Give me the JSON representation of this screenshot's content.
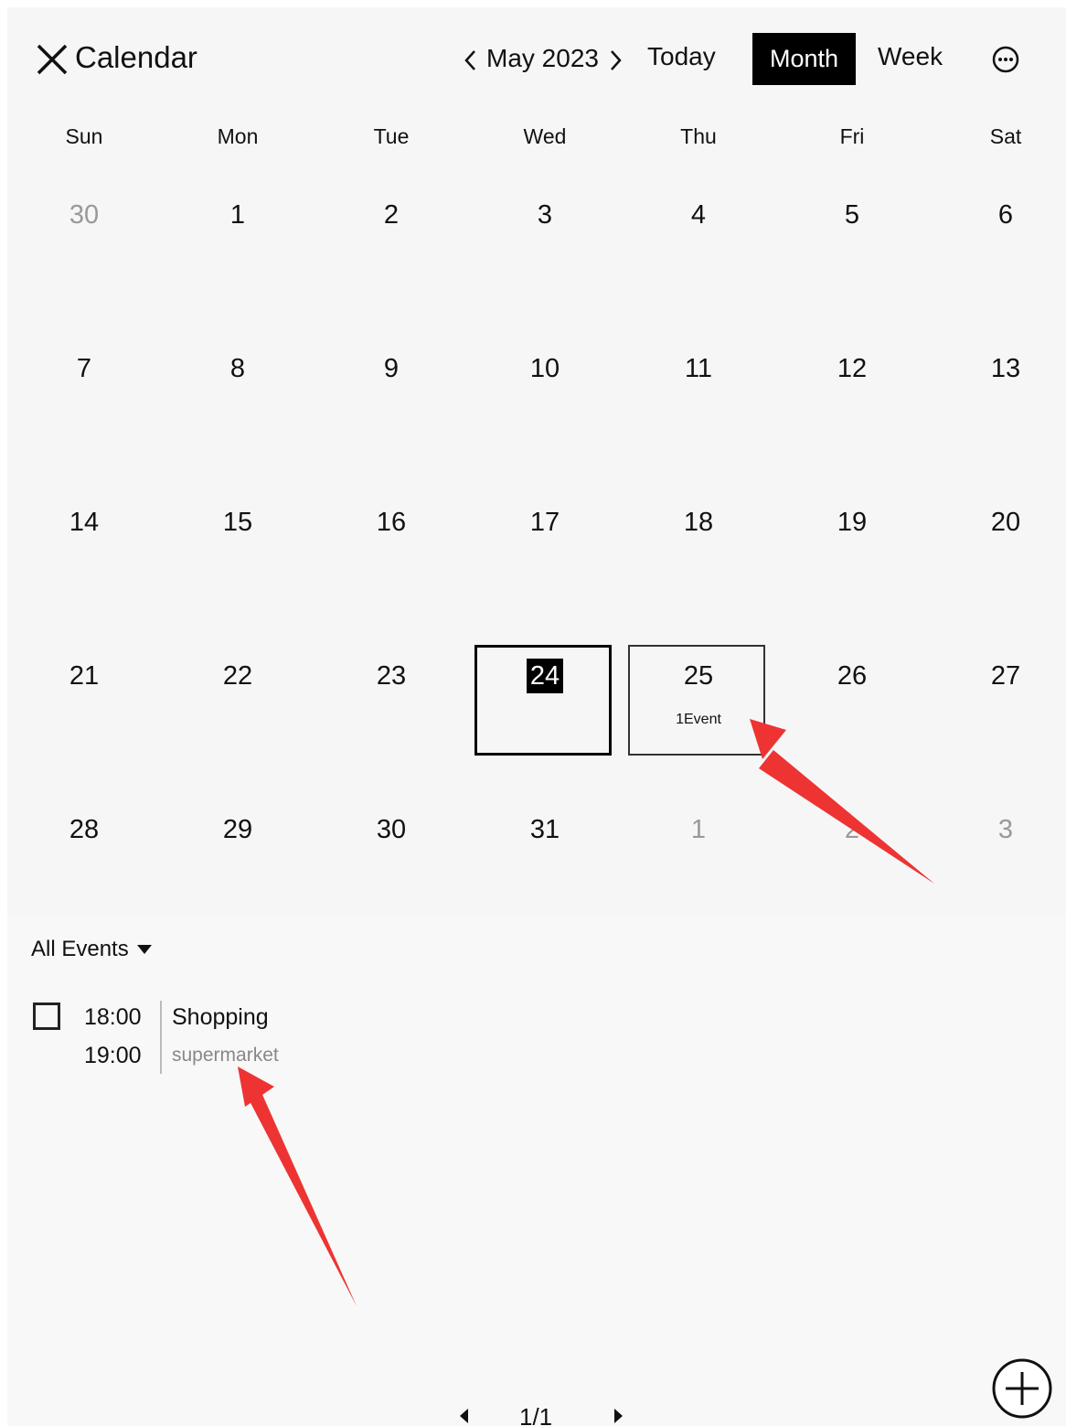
{
  "header": {
    "title": "Calendar",
    "month_label": "May 2023",
    "today_label": "Today",
    "month_label_btn": "Month",
    "week_label": "Week"
  },
  "weekdays": [
    "Sun",
    "Mon",
    "Tue",
    "Wed",
    "Thu",
    "Fri",
    "Sat"
  ],
  "weeks": [
    [
      "30",
      "1",
      "2",
      "3",
      "4",
      "5",
      "6"
    ],
    [
      "7",
      "8",
      "9",
      "10",
      "11",
      "12",
      "13"
    ],
    [
      "14",
      "15",
      "16",
      "17",
      "18",
      "19",
      "20"
    ],
    [
      "21",
      "22",
      "23",
      "24",
      "25",
      "26",
      "27"
    ],
    [
      "28",
      "29",
      "30",
      "31",
      "1",
      "2",
      "3"
    ]
  ],
  "today": "24",
  "selected_day": "25",
  "selected_day_events": "1Event",
  "events": {
    "filter_label": "All Events",
    "items": [
      {
        "start": "18:00",
        "end": "19:00",
        "title": "Shopping",
        "location": "supermarket"
      }
    ],
    "page": "1/1"
  },
  "colors": {
    "accent": "#000000",
    "annotation_arrow": "#ee3333",
    "muted_day": "#999999"
  }
}
